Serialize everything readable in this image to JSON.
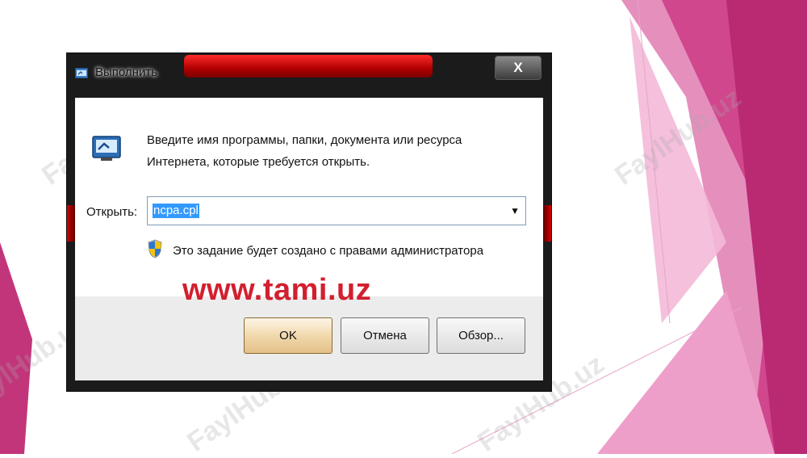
{
  "dialog": {
    "title": "Выполнить",
    "close_label": "X",
    "prompt_line1": "Введите имя программы, папки, документа или ресурса",
    "prompt_line2": "Интернета, которые требуется открыть.",
    "open_label": "Открыть:",
    "open_value": "ncpa.cpl",
    "dropdown_glyph": "▼",
    "admin_note": "Это задание будет создано с правами администратора",
    "buttons": {
      "ok": "OK",
      "cancel": "Отмена",
      "browse": "Обзор..."
    }
  },
  "overlay": {
    "site_text": "www.tami.uz",
    "watermark": "FaylHub.uz"
  },
  "icons": [
    "run-icon",
    "shield-icon",
    "close-icon",
    "chevron-down-icon"
  ],
  "colors": {
    "accent_pink": "#c2357a",
    "light_pink": "#ea86bc",
    "title_glow_red": "#d40000",
    "site_text_red": "#d21f2f",
    "selection_blue": "#3399ff"
  }
}
